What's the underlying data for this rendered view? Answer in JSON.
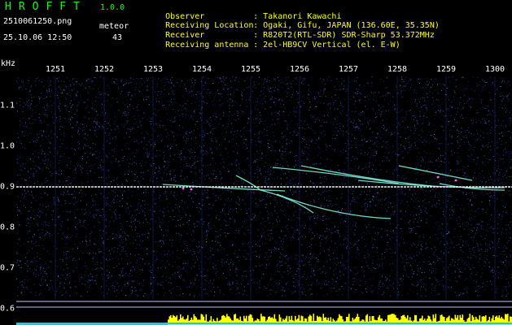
{
  "header": {
    "app_title": "HROFFT",
    "app_version": "1.0.0",
    "file_name": "2510061250.png",
    "meteor_label": "meteor",
    "date_time": "25.10.06 12:50",
    "meteor_count": "43"
  },
  "station": {
    "observer_label": "Observer",
    "observer_value": ": Takanori Kawachi",
    "location_label": "Receiving Location",
    "location_value": ": Ogaki, Gifu, JAPAN (136.60E, 35.35N)",
    "receiver_label": "Receiver",
    "receiver_value": ": R820T2(RTL-SDR) SDR-Sharp 53.372MHz",
    "antenna_label": "Receiving antenna",
    "antenna_value": ": 2el-HB9CV Vertical (el. E-W)"
  },
  "axes": {
    "y_unit": "kHz",
    "x_ticks": [
      "1251",
      "1252",
      "1253",
      "1254",
      "1255",
      "1256",
      "1257",
      "1258",
      "1259",
      "1300"
    ],
    "y_ticks": [
      "1.1",
      "1.0",
      "0.9",
      "0.8",
      "0.7",
      "0.6"
    ]
  },
  "colors": {
    "background": "#000000",
    "noise": "#1a2a88",
    "carrier": "#f0f0f0",
    "meteor": "#80ffe0",
    "level_meter": "#ffff00",
    "level_baseline": "#00d0ff",
    "title_green": "#00ff00",
    "info_yellow": "#ffff00"
  }
}
